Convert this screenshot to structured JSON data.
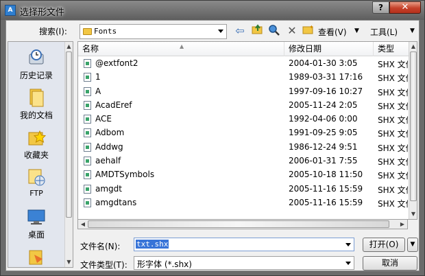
{
  "window": {
    "title": "选择形文件",
    "help_label": "?",
    "close_label": "✕"
  },
  "toolbar": {
    "look_in_label": "搜索(I):",
    "look_in_value": "Fonts",
    "views_label": "查看(V)",
    "tools_label": "工具(L)"
  },
  "places": [
    {
      "label": "历史记录",
      "icon": "history-icon"
    },
    {
      "label": "我的文档",
      "icon": "documents-icon"
    },
    {
      "label": "收藏夹",
      "icon": "favorites-icon"
    },
    {
      "label": "FTP",
      "icon": "ftp-icon"
    },
    {
      "label": "桌面",
      "icon": "desktop-icon"
    },
    {
      "label": "",
      "icon": "buzzsaw-icon"
    }
  ],
  "list": {
    "columns": {
      "name": "名称",
      "date": "修改日期",
      "type": "类型"
    },
    "rows": [
      {
        "name": "@extfont2",
        "date": "2004-01-30 3:05",
        "type": "SHX 文件"
      },
      {
        "name": "1",
        "date": "1989-03-31 17:16",
        "type": "SHX 文件"
      },
      {
        "name": "A",
        "date": "1997-09-16 10:27",
        "type": "SHX 文件"
      },
      {
        "name": "AcadEref",
        "date": "2005-11-24 2:05",
        "type": "SHX 文件"
      },
      {
        "name": "ACE",
        "date": "1992-04-06 0:00",
        "type": "SHX 文件"
      },
      {
        "name": "Adbom",
        "date": "1991-09-25 9:05",
        "type": "SHX 文件"
      },
      {
        "name": "Addwg",
        "date": "1986-12-24 9:51",
        "type": "SHX 文件"
      },
      {
        "name": "aehalf",
        "date": "2006-01-31 7:55",
        "type": "SHX 文件"
      },
      {
        "name": "AMDTSymbols",
        "date": "2005-10-18 11:50",
        "type": "SHX 文件"
      },
      {
        "name": "amgdt",
        "date": "2005-11-16 15:59",
        "type": "SHX 文件"
      },
      {
        "name": "amgdtans",
        "date": "2005-11-16 15:59",
        "type": "SHX 文件"
      }
    ]
  },
  "form": {
    "filename_label": "文件名(N):",
    "filename_value": "txt.shx",
    "filetype_label": "文件类型(T):",
    "filetype_value": "形字体 (*.shx)",
    "open_label": "打开(O)",
    "cancel_label": "取消"
  }
}
